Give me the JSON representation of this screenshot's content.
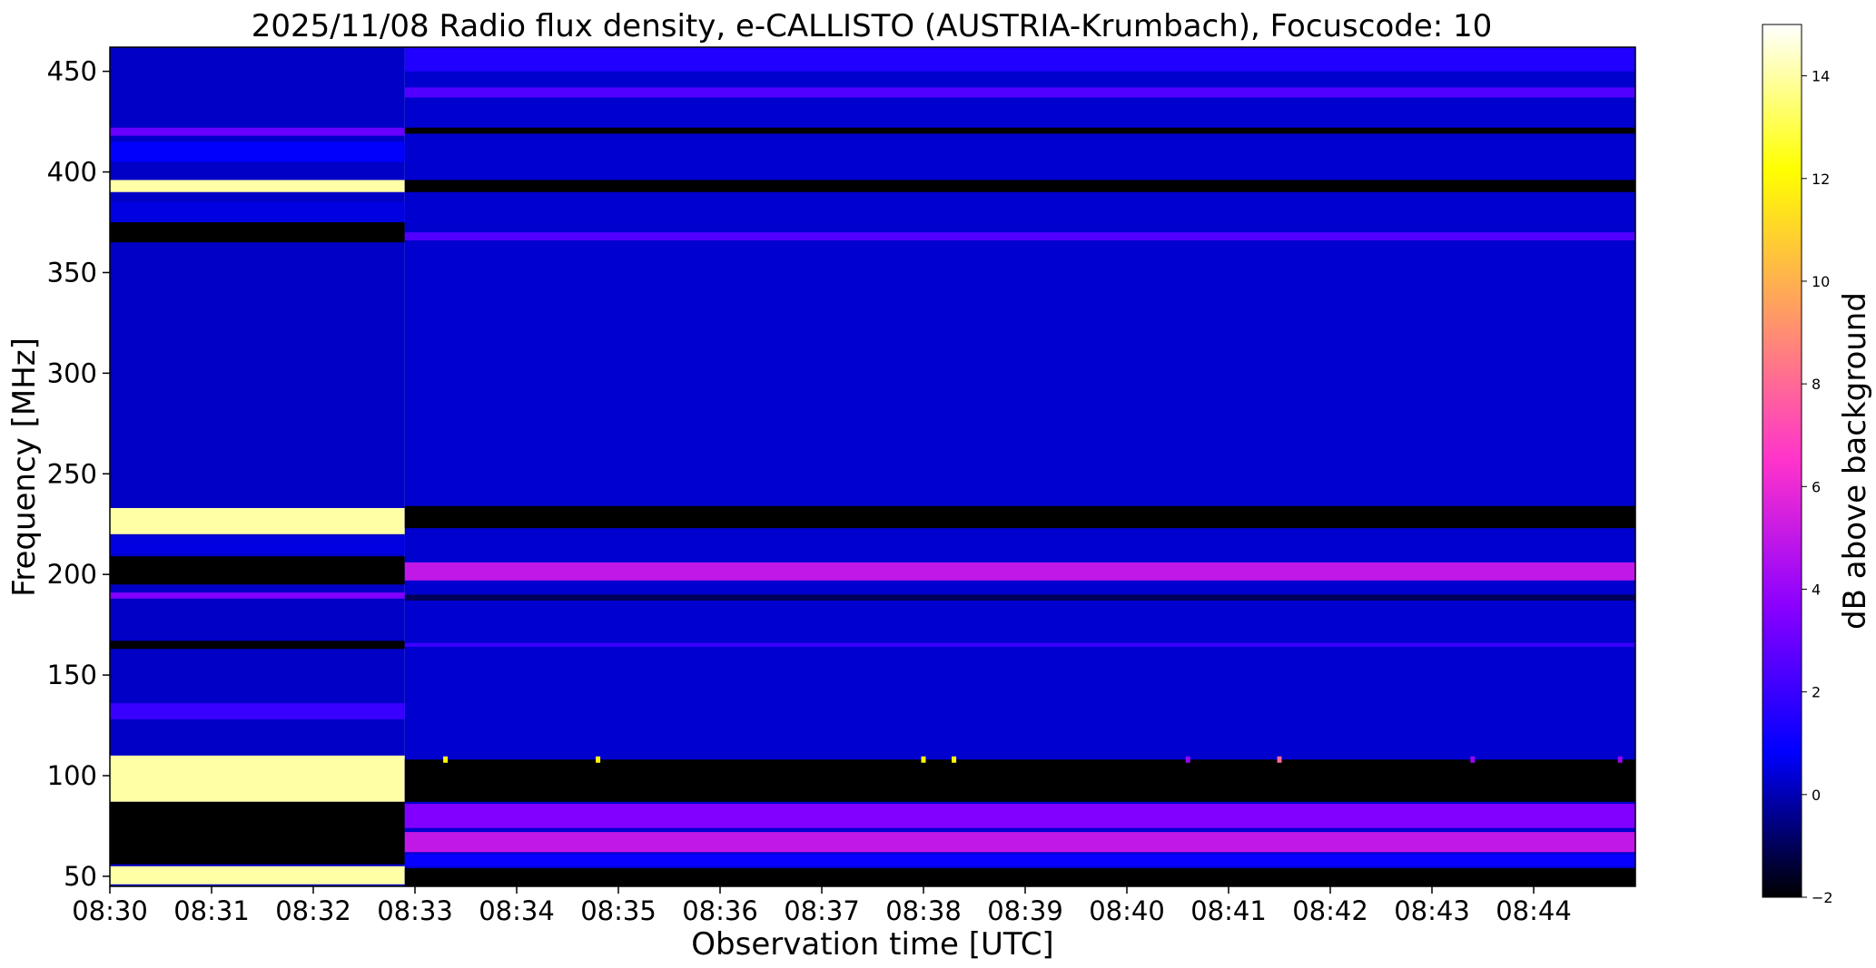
{
  "chart_data": {
    "type": "heatmap",
    "title": "2025/11/08  Radio flux density, e-CALLISTO (AUSTRIA-Krumbach), Focuscode: 10",
    "xlabel": "Observation time [UTC]",
    "ylabel": "Frequency [MHz]",
    "x_ticks": [
      "08:30",
      "08:31",
      "08:32",
      "08:33",
      "08:34",
      "08:35",
      "08:36",
      "08:37",
      "08:38",
      "08:39",
      "08:40",
      "08:41",
      "08:42",
      "08:43",
      "08:44"
    ],
    "x_range_minutes": [
      0,
      15
    ],
    "y_ticks": [
      50,
      100,
      150,
      200,
      250,
      300,
      350,
      400,
      450
    ],
    "ylim": [
      45,
      462
    ],
    "colormap": "gnuplot2",
    "colorbar": {
      "label": "dB above background",
      "ticks": [
        -2,
        0,
        2,
        4,
        6,
        8,
        10,
        12,
        14
      ],
      "range": [
        -2,
        15
      ],
      "colors": [
        "#000000",
        "#0000ff",
        "#8a00ff",
        "#ff33cc",
        "#ff9966",
        "#ffff00",
        "#ffffff"
      ]
    },
    "segments": [
      {
        "name": "08:30–08:33",
        "t_start": 0.0,
        "t_end": 2.9,
        "background_db": 0.2,
        "bands": [
          {
            "f_lo": 418,
            "f_hi": 422,
            "db": 3
          },
          {
            "f_lo": 405,
            "f_hi": 415,
            "db": 0.8
          },
          {
            "f_lo": 390,
            "f_hi": 396,
            "db": 14
          },
          {
            "f_lo": 375,
            "f_hi": 385,
            "db": 0.5
          },
          {
            "f_lo": 365,
            "f_hi": 375,
            "db": -2
          },
          {
            "f_lo": 220,
            "f_hi": 233,
            "db": 14
          },
          {
            "f_lo": 210,
            "f_hi": 219,
            "db": 0.5
          },
          {
            "f_lo": 195,
            "f_hi": 209,
            "db": -2
          },
          {
            "f_lo": 188,
            "f_hi": 191,
            "db": 3.5
          },
          {
            "f_lo": 163,
            "f_hi": 167,
            "db": -2
          },
          {
            "f_lo": 128,
            "f_hi": 136,
            "db": 2
          },
          {
            "f_lo": 87,
            "f_hi": 110,
            "db": 14
          },
          {
            "f_lo": 56,
            "f_hi": 87,
            "db": -2
          },
          {
            "f_lo": 46,
            "f_hi": 55,
            "db": 14
          }
        ]
      },
      {
        "name": "08:33–08:45",
        "t_start": 2.9,
        "t_end": 15.0,
        "background_db": 0.3,
        "bands": [
          {
            "f_lo": 450,
            "f_hi": 462,
            "db": 1.5
          },
          {
            "f_lo": 437,
            "f_hi": 442,
            "db": 2.5
          },
          {
            "f_lo": 419,
            "f_hi": 422,
            "db": -2
          },
          {
            "f_lo": 390,
            "f_hi": 396,
            "db": -2
          },
          {
            "f_lo": 366,
            "f_hi": 370,
            "db": 2.5
          },
          {
            "f_lo": 223,
            "f_hi": 234,
            "db": -2
          },
          {
            "f_lo": 197,
            "f_hi": 206,
            "db": 5
          },
          {
            "f_lo": 187,
            "f_hi": 190,
            "db": -1
          },
          {
            "f_lo": 164,
            "f_hi": 166,
            "db": 2
          },
          {
            "f_lo": 87,
            "f_hi": 108,
            "db": -2
          },
          {
            "f_lo": 74,
            "f_hi": 86,
            "db": 3.5
          },
          {
            "f_lo": 62,
            "f_hi": 72,
            "db": 5
          },
          {
            "f_lo": 55,
            "f_hi": 61,
            "db": 1
          },
          {
            "f_lo": 45,
            "f_hi": 54,
            "db": -2
          }
        ]
      }
    ],
    "bright_spots": [
      {
        "t": 3.3,
        "f": 108,
        "db": 12
      },
      {
        "t": 4.8,
        "f": 108,
        "db": 12
      },
      {
        "t": 8.0,
        "f": 108,
        "db": 12
      },
      {
        "t": 8.3,
        "f": 108,
        "db": 12
      },
      {
        "t": 10.6,
        "f": 108,
        "db": 4
      },
      {
        "t": 11.5,
        "f": 108,
        "db": 8
      },
      {
        "t": 13.4,
        "f": 108,
        "db": 4
      },
      {
        "t": 14.85,
        "f": 108,
        "db": 4
      }
    ]
  }
}
